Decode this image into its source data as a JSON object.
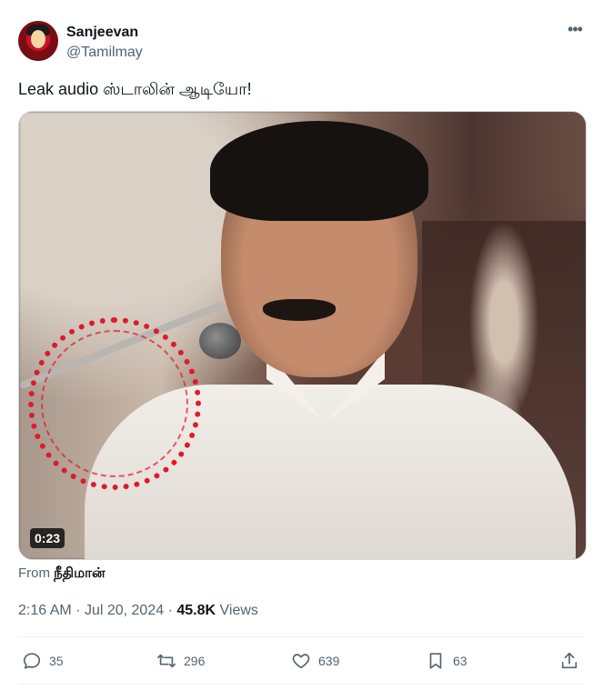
{
  "author": {
    "display_name": "Sanjeevan",
    "handle": "@Tamilmay"
  },
  "tweet": {
    "text": "Leak audio ஸ்டாலின் ஆடியோ!"
  },
  "media": {
    "duration": "0:23"
  },
  "source": {
    "prefix": "From",
    "name": "நீதிமான்"
  },
  "meta": {
    "time": "2:16 AM",
    "separator": "·",
    "date": "Jul 20, 2024",
    "views_count": "45.8K",
    "views_label": "Views"
  },
  "actions": {
    "replies": "35",
    "retweets": "296",
    "likes": "639",
    "bookmarks": "63"
  },
  "icons": [
    "more-icon",
    "reply-icon",
    "retweet-icon",
    "like-icon",
    "bookmark-icon",
    "share-icon"
  ]
}
